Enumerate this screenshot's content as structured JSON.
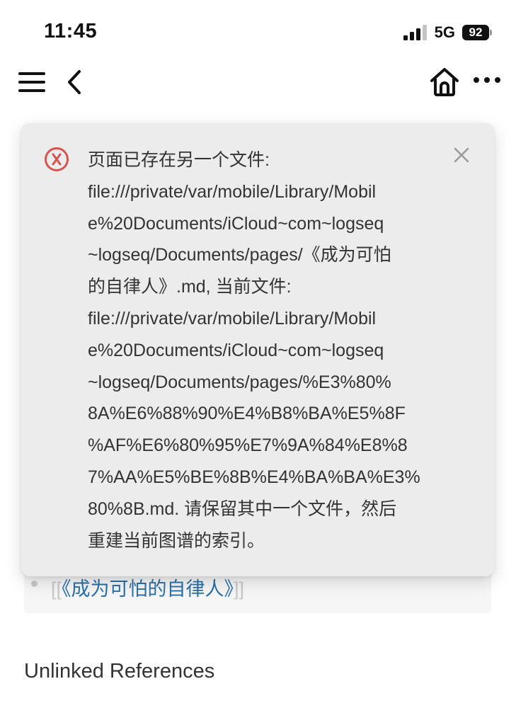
{
  "status_bar": {
    "time": "11:45",
    "network": "5G",
    "battery": "92"
  },
  "nav": {
    "icons": [
      "menu-icon",
      "back-icon",
      "home-icon",
      "more-icon"
    ]
  },
  "toast": {
    "type": "error",
    "icon": "error-icon",
    "accent_color": "#d9534f",
    "lines": [
      "页面已存在另一个文件:",
      "file:///private/var/mobile/Library/Mobil",
      "e%20Documents/iCloud~com~logseq",
      "~logseq/Documents/pages/《成为可怕",
      "的自律人》.md, 当前文件:",
      "file:///private/var/mobile/Library/Mobil",
      "e%20Documents/iCloud~com~logseq",
      "~logseq/Documents/pages/%E3%80%",
      "8A%E6%88%90%E4%B8%BA%E5%8F",
      "%AF%E6%80%95%E7%9A%84%E8%8",
      "7%AA%E5%BE%8B%E4%BA%BA%E3%",
      "80%8B.md. 请保留其中一个文件，然后",
      "重建当前图谱的索引。"
    ]
  },
  "reference": {
    "bracket_open": "[[",
    "link_text": "《成为可怕的自律人》",
    "bracket_close": "]]",
    "link_color": "#2a6fa8"
  },
  "unlinked_references": {
    "title": "Unlinked References"
  }
}
